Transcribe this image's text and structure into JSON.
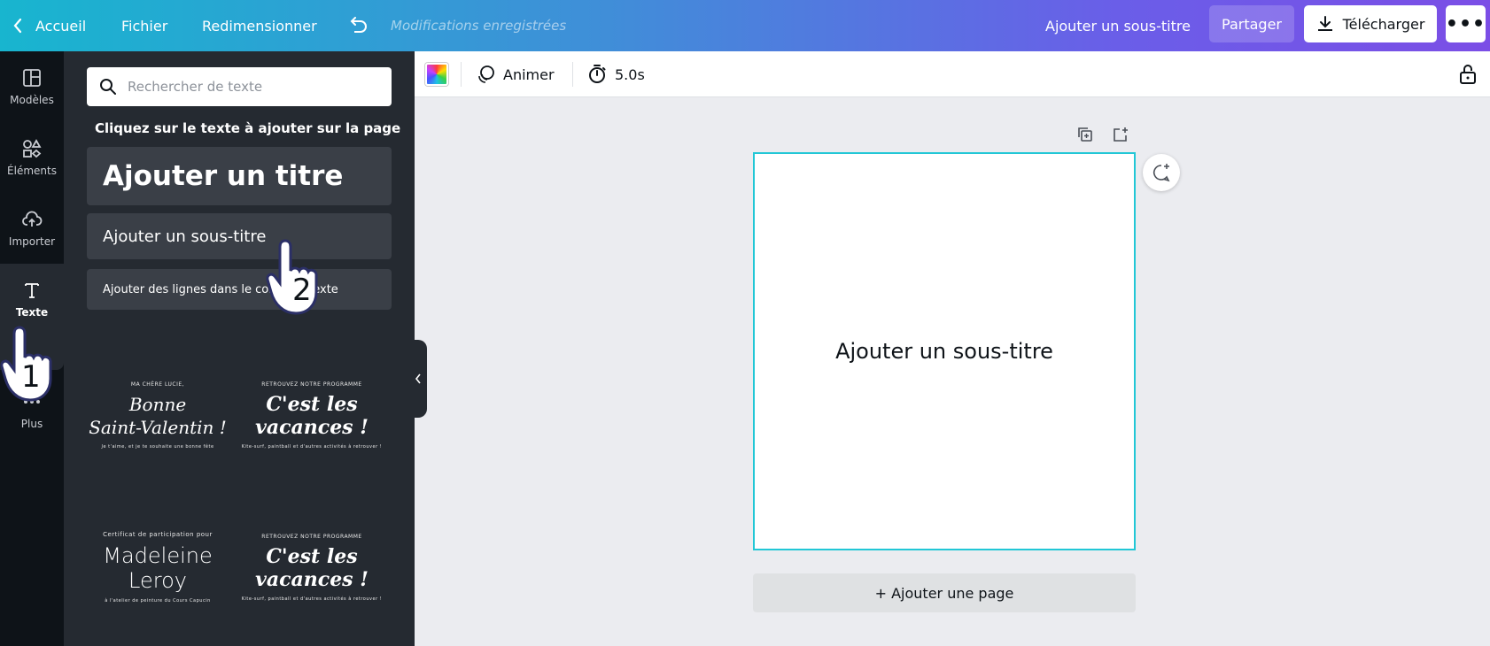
{
  "topbar": {
    "home": "Accueil",
    "file": "Fichier",
    "resize": "Redimensionner",
    "saved_status": "Modifications enregistrées",
    "doc_title": "Ajouter un sous-titre",
    "share": "Partager",
    "download": "Télécharger",
    "more": "•••"
  },
  "rail": {
    "items": [
      {
        "label": "Modèles",
        "icon": "templates-icon"
      },
      {
        "label": "Éléments",
        "icon": "elements-icon"
      },
      {
        "label": "Importer",
        "icon": "upload-icon"
      },
      {
        "label": "Texte",
        "icon": "text-icon"
      },
      {
        "label": "Plus",
        "icon": "more-icon"
      }
    ]
  },
  "panel": {
    "search_placeholder": "Rechercher de texte",
    "hint": "Cliquez sur le texte à ajouter sur la page",
    "add_title": "Ajouter un titre",
    "add_subtitle": "Ajouter un sous-titre",
    "add_body": "Ajouter des lignes dans le corps de texte",
    "templates": [
      {
        "top": "MA CHÈRE LUCIE,",
        "main_1": "Bonne",
        "main_2": "Saint-Valentin !",
        "bottom": "Je t'aime, et je te souhaite une bonne fête"
      },
      {
        "top": "RETROUVEZ NOTRE PROGRAMME",
        "main_1": "C'est les",
        "main_2": "vacances !",
        "bottom": "Kite-surf, paintball et d'autres activités à retrouver !"
      },
      {
        "top": "Certificat de participation pour",
        "main_1": "Madeleine",
        "main_2": "Leroy",
        "bottom": "à l'atelier de peinture du Cours Capucin"
      },
      {
        "top": "RETROUVEZ NOTRE PROGRAMME",
        "main_1": "C'est les",
        "main_2": "vacances !",
        "bottom": "Kite-surf, paintball et d'autres activités à retrouver !"
      }
    ]
  },
  "toolbar": {
    "animate": "Animer",
    "duration": "5.0s"
  },
  "canvas": {
    "page_text": "Ajouter un sous-titre",
    "add_page": "+ Ajouter une page"
  },
  "annotations": {
    "step1": "1",
    "step2": "2"
  },
  "colors": {
    "accent_border": "#22c7d6",
    "panel_bg": "#252a31",
    "rail_bg": "#0e1318"
  }
}
